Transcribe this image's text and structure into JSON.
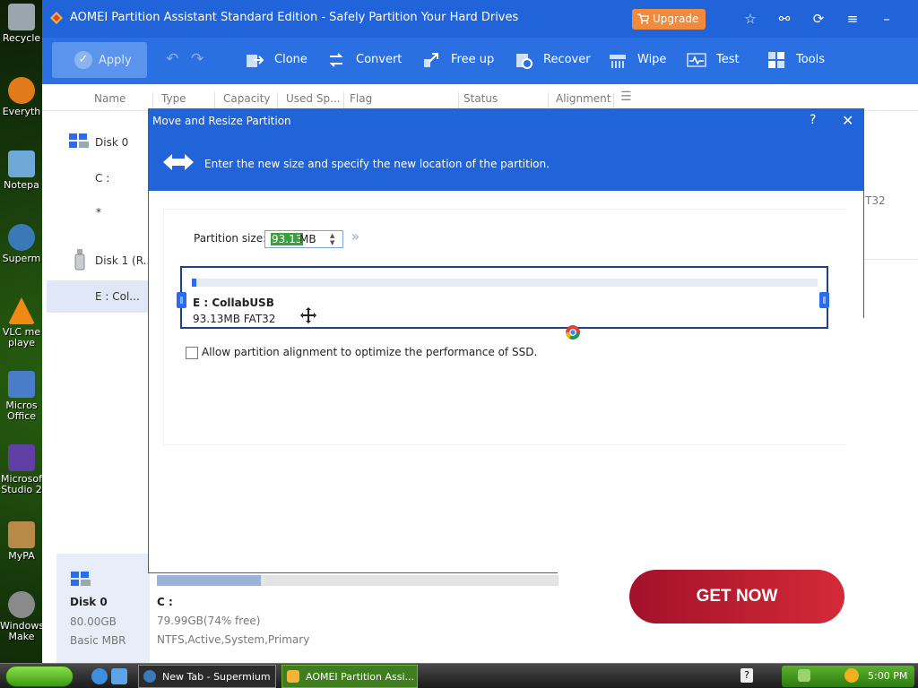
{
  "desktop": {
    "icons": [
      {
        "label": "Recycle",
        "color": "#9aa6ae"
      },
      {
        "label": "Everyth",
        "color": "#e07a1b"
      },
      {
        "label": "Notepa",
        "color": "#6ea9d8"
      },
      {
        "label": "Superm",
        "color": "#3a78b8"
      },
      {
        "label": "VLC me playe",
        "color": "#f08a12"
      },
      {
        "label": "Micros Office",
        "color": "#4a7dc7"
      },
      {
        "label": "Microsof Studio 2",
        "color": "#5f3fa3"
      },
      {
        "label": "MyPA",
        "color": "#b88a4a"
      },
      {
        "label": "Windows Make",
        "color": "#8a8a8a"
      }
    ]
  },
  "app": {
    "title": "AOMEI Partition Assistant Standard Edition - Safely Partition Your Hard Drives",
    "upgrade_label": "Upgrade",
    "title_icons": [
      "star-icon",
      "share-icon",
      "refresh-icon",
      "menu-icon",
      "minimize-icon"
    ],
    "toolbar": {
      "apply_label": "Apply",
      "items": [
        {
          "label": "Clone",
          "icon": "clone-icon"
        },
        {
          "label": "Convert",
          "icon": "convert-icon"
        },
        {
          "label": "Free up",
          "icon": "free-up-icon"
        },
        {
          "label": "Recover",
          "icon": "recover-icon"
        },
        {
          "label": "Wipe",
          "icon": "wipe-icon"
        },
        {
          "label": "Test",
          "icon": "test-icon"
        },
        {
          "label": "Tools",
          "icon": "tools-icon"
        }
      ]
    },
    "columns": [
      "Name",
      "Type",
      "Capacity",
      "Used Sp...",
      "Flag",
      "Status",
      "Alignment"
    ],
    "left_tree": [
      {
        "label": "Disk 0"
      },
      {
        "label": "C :"
      },
      {
        "label": "*"
      },
      {
        "label": "Disk 1 (R..."
      },
      {
        "label": "E : Col..."
      }
    ],
    "right_partial_text": "T32",
    "bottom": {
      "disk_name": "Disk 0",
      "disk_size": "80.00GB",
      "disk_type": "Basic MBR",
      "partition_name": "C :",
      "partition_usage": "79.99GB(74% free)",
      "partition_flags": "NTFS,Active,System,Primary",
      "used_fraction": 0.26
    }
  },
  "dialog": {
    "title": "Move and Resize Partition",
    "help_label": "?",
    "close_label": "✕",
    "hint": "Enter the new size and specify the new location of the partition.",
    "partition_size_label": "Partition size:",
    "partition_size_value": "93.13",
    "partition_size_unit": "MB",
    "partition_name": "E : CollabUSB",
    "partition_desc": "93.13MB FAT32",
    "alignment_label": "Allow partition alignment to optimize the performance of SSD.",
    "alignment_checked": false
  },
  "ad": {
    "label": "GET NOW"
  },
  "taskbar": {
    "tasks": [
      {
        "label": "New Tab - Supermium"
      },
      {
        "label": "AOMEI Partition Assi..."
      }
    ],
    "clock": "5:00 PM"
  },
  "colors": {
    "brand_blue": "#2163d8",
    "toolbar_blue": "#2a70e2",
    "upgrade_orange": "#f08a3c",
    "ad_red": "#bf1b2c"
  }
}
